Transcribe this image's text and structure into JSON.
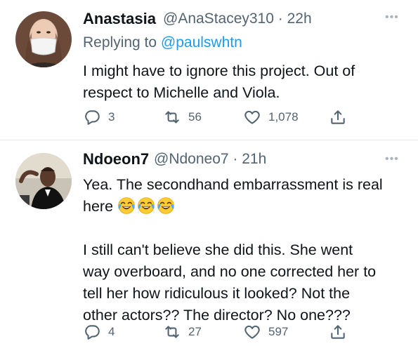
{
  "tweets": [
    {
      "name": "Anastasia",
      "handle": "@AnaStacey310",
      "sep": "·",
      "time": "22h",
      "replying_prefix": "Replying to",
      "replying_handle": "@paulswhtn",
      "text_lines": [
        "I might have to ignore this project. Out of",
        "respect to Michelle and Viola."
      ],
      "replies": "3",
      "retweets": "56",
      "likes": "1,078"
    },
    {
      "name": "Ndoeon7",
      "handle": "@Ndoneo7",
      "sep": "·",
      "time": "21h",
      "text_line1": "Yea. The secondhand embarrassment is real",
      "text_line2": "here",
      "emoji_count": 3,
      "emoji_name": "face-with-tears-of-joy",
      "paragraph2": [
        "I still can't believe she did this. She went",
        "way overboard, and no one corrected her to",
        "tell her how ridiculous it looked? Not the",
        "other actors?? The director? No one???"
      ],
      "replies": "4",
      "retweets": "27",
      "likes": "597"
    }
  ],
  "icons": {
    "more": "more-horizontal-icon",
    "reply": "reply-icon",
    "retweet": "retweet-icon",
    "like": "heart-icon",
    "share": "share-icon"
  },
  "colors": {
    "text": "#0f1419",
    "secondary": "#536471",
    "link": "#1d9bf0"
  }
}
